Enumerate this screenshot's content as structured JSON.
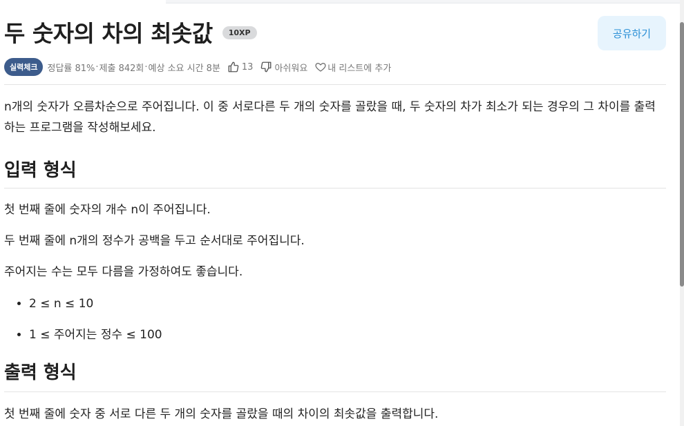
{
  "problem": {
    "title": "두 숫자의 차의 최솟값",
    "xp_badge": "10XP",
    "share_label": "공유하기",
    "level_badge": "실력체크",
    "accuracy": "정답률 81%",
    "separator": "·",
    "submissions": "제출 842회",
    "expected_time": "예상 소요 시간 8분",
    "likes": "13",
    "dislike_label": "아쉬워요",
    "add_to_list_label": "내 리스트에 추가"
  },
  "body": {
    "description": "n개의 숫자가 오름차순으로 주어집니다. 이 중 서로다른 두 개의 숫자를 골랐을 때, 두 숫자의 차가 최소가 되는 경우의 그 차이를 출력하는 프로그램을 작성해보세요.",
    "input_heading": "입력 형식",
    "input_line_1": "첫 번째 줄에 숫자의 개수 n이 주어집니다.",
    "input_line_2": "두 번째 줄에 n개의 정수가 공백을 두고 순서대로 주어집니다.",
    "input_line_3": "주어지는 수는 모두 다름을 가정하여도 좋습니다.",
    "constraint_1": "2 ≤ n ≤ 10",
    "constraint_2": "1 ≤ 주어지는 정수 ≤ 100",
    "output_heading": "출력 형식",
    "output_line_1": "첫 번째 줄에 숫자 중 서로 다른 두 개의 숫자를 골랐을 때의 차이의 최솟값을 출력합니다."
  },
  "colors": {
    "level_badge_bg": "#3d5c8c",
    "share_button_bg": "#e7f4fd",
    "share_button_text": "#2a8fd6"
  },
  "icons": [
    "thumbs-up-icon",
    "thumbs-down-icon",
    "heart-icon"
  ]
}
